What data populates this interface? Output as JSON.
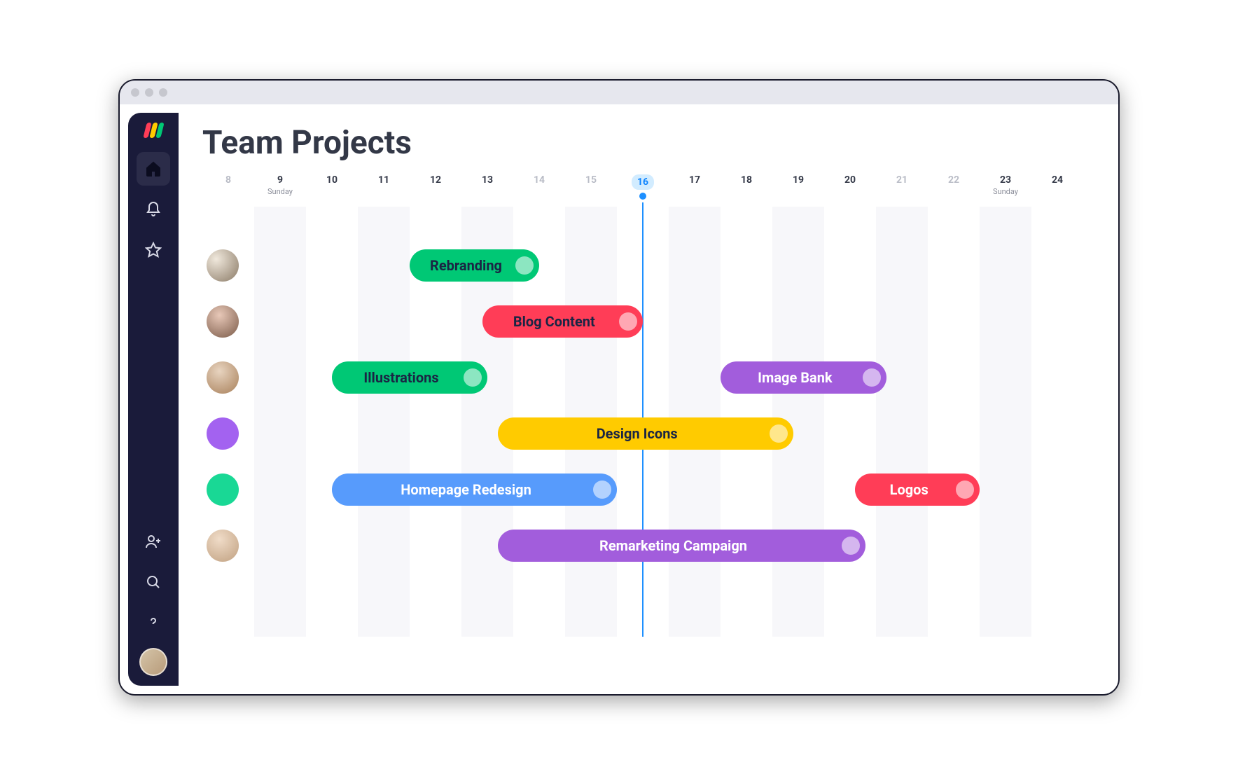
{
  "page_title": "Team Projects",
  "timeline": {
    "days": [
      {
        "num": "8",
        "muted": true,
        "sub": ""
      },
      {
        "num": "9",
        "muted": false,
        "sub": "Sunday"
      },
      {
        "num": "10",
        "muted": false,
        "sub": ""
      },
      {
        "num": "11",
        "muted": false,
        "sub": ""
      },
      {
        "num": "12",
        "muted": false,
        "sub": ""
      },
      {
        "num": "13",
        "muted": false,
        "sub": ""
      },
      {
        "num": "14",
        "muted": true,
        "sub": ""
      },
      {
        "num": "15",
        "muted": true,
        "sub": ""
      },
      {
        "num": "16",
        "muted": false,
        "sub": "",
        "today": true
      },
      {
        "num": "17",
        "muted": false,
        "sub": ""
      },
      {
        "num": "18",
        "muted": false,
        "sub": ""
      },
      {
        "num": "19",
        "muted": false,
        "sub": ""
      },
      {
        "num": "20",
        "muted": false,
        "sub": ""
      },
      {
        "num": "21",
        "muted": true,
        "sub": ""
      },
      {
        "num": "22",
        "muted": true,
        "sub": ""
      },
      {
        "num": "23",
        "muted": false,
        "sub": "Sunday"
      },
      {
        "num": "24",
        "muted": false,
        "sub": ""
      }
    ],
    "today_index": 8
  },
  "chart_data": {
    "type": "gantt",
    "x_unit": "day",
    "x_range": [
      8,
      24
    ],
    "today": 16,
    "rows": [
      {
        "assignee": "member-1",
        "bars": [
          {
            "label": "Rebranding",
            "start": 12,
            "end": 14.5,
            "color": "green"
          }
        ]
      },
      {
        "assignee": "member-2",
        "bars": [
          {
            "label": "Blog Content",
            "start": 13.4,
            "end": 16.5,
            "color": "red"
          }
        ]
      },
      {
        "assignee": "member-3",
        "bars": [
          {
            "label": "Illustrations",
            "start": 10.5,
            "end": 13.5,
            "color": "green"
          },
          {
            "label": "Image Bank",
            "start": 18.0,
            "end": 21.2,
            "color": "purple"
          }
        ]
      },
      {
        "assignee": "member-4",
        "bars": [
          {
            "label": "Design Icons",
            "start": 13.7,
            "end": 19.4,
            "color": "yellow"
          }
        ]
      },
      {
        "assignee": "member-5",
        "bars": [
          {
            "label": "Homepage Redesign",
            "start": 10.5,
            "end": 16.0,
            "color": "blue"
          },
          {
            "label": "Logos",
            "start": 20.6,
            "end": 23.0,
            "color": "red2"
          }
        ]
      },
      {
        "assignee": "member-6",
        "bars": [
          {
            "label": "Remarketing Campaign",
            "start": 13.7,
            "end": 20.8,
            "color": "purple"
          }
        ]
      }
    ]
  },
  "sidebar": {
    "icons": {
      "home": "home-icon",
      "bell": "bell-icon",
      "star": "star-icon",
      "invite": "user-plus-icon",
      "search": "search-icon",
      "help": "help-icon"
    }
  }
}
